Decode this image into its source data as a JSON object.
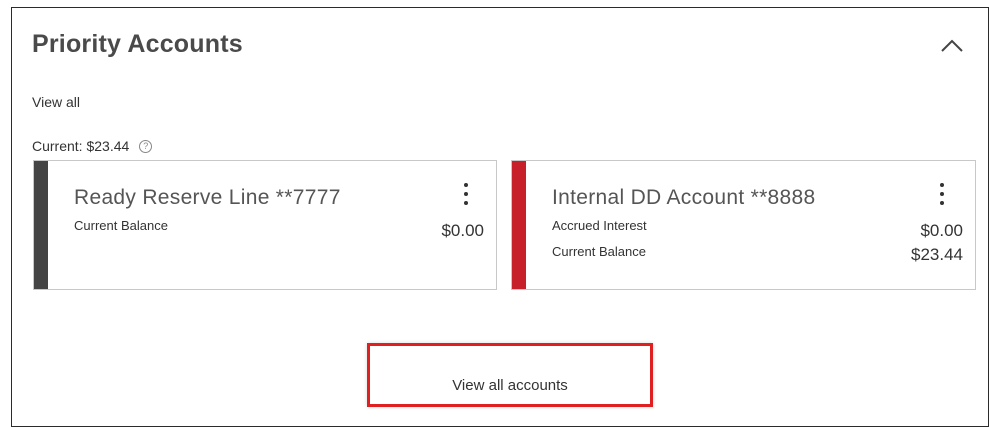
{
  "panel": {
    "title": "Priority Accounts",
    "view_all_label": "View all",
    "current_label": "Current: $23.44",
    "help_icon": "?"
  },
  "accounts": [
    {
      "name": "Ready Reserve Line **7777",
      "stripe_color": "#444444",
      "rows": [
        {
          "label": "Current Balance",
          "value": "$0.00"
        }
      ]
    },
    {
      "name": "Internal DD Account **8888",
      "stripe_color": "#c8202a",
      "rows": [
        {
          "label": "Accrued Interest",
          "value": "$0.00"
        },
        {
          "label": "Current Balance",
          "value": "$23.44"
        }
      ]
    }
  ],
  "footer": {
    "view_all_accounts_label": "View all accounts",
    "highlight_color": "#e02020"
  },
  "icons": {
    "collapse": "chevron-up-icon",
    "menu": "kebab-menu-icon",
    "help": "help-circle-icon"
  }
}
